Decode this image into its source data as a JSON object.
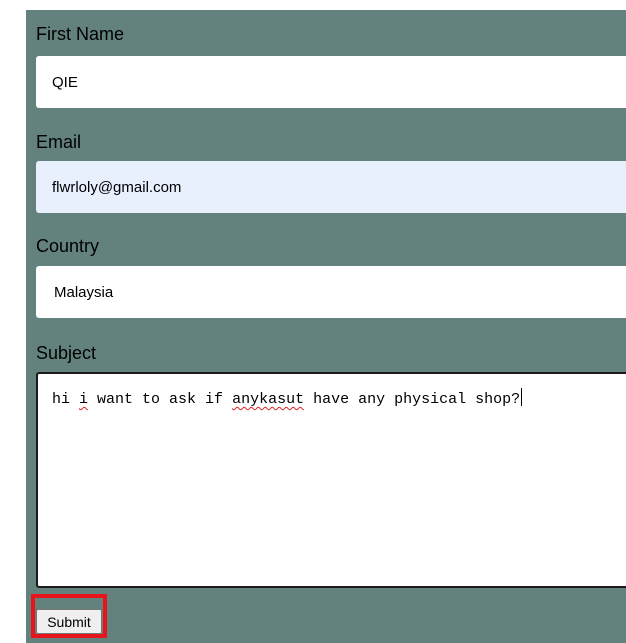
{
  "form": {
    "first_name": {
      "label": "First Name",
      "value": "QIE"
    },
    "email": {
      "label": "Email",
      "value": "flwrloly@gmail.com"
    },
    "country": {
      "label": "Country",
      "selected": "Malaysia"
    },
    "subject": {
      "label": "Subject",
      "text_parts": [
        "hi ",
        "i",
        " want to ask if ",
        "anykasut",
        " have any physical shop?"
      ]
    },
    "submit_label": "Submit"
  },
  "colors": {
    "panel_background": "#63827e",
    "autofill_background": "#e8f0fe",
    "highlight_border": "#e8141c",
    "spellcheck_underline": "#dd2222"
  }
}
